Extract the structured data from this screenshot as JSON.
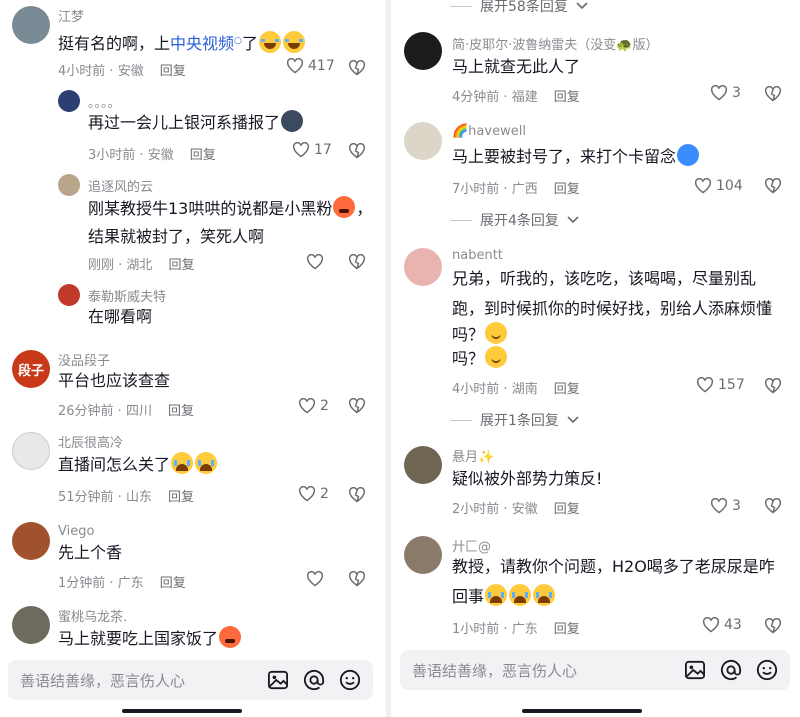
{
  "left": {
    "comments": [
      {
        "user": "江梦",
        "text_a": "挺有名的啊，上",
        "text_link": "中央视频",
        "text_b": "了",
        "time": "4小时前",
        "loc": "安徽",
        "reply": "回复",
        "likes": "417"
      },
      {
        "user": "。。。。",
        "text": "再过一会儿上银河系播报了",
        "time": "3小时前",
        "loc": "安徽",
        "reply": "回复",
        "likes": "17"
      },
      {
        "user": "追逐风的云",
        "text_l1": "刚某教授牛13哄哄的说都是小黑粉",
        "text_l1b": "，",
        "text_l2": "结果就被封了，笑死人啊",
        "time": "刚刚",
        "loc": "湖北",
        "reply": "回复"
      },
      {
        "user": "泰勒斯威夫特",
        "text": "在哪看啊"
      },
      {
        "user": "没品段子",
        "avatar_text": "段子",
        "text": "平台也应该查查",
        "time": "26分钟前",
        "loc": "四川",
        "reply": "回复",
        "likes": "2"
      },
      {
        "user": "北辰很高冷",
        "text": "直播间怎么关了",
        "time": "51分钟前",
        "loc": "山东",
        "reply": "回复",
        "likes": "2"
      },
      {
        "user": "Viego",
        "text": "先上个香",
        "time": "1分钟前",
        "loc": "广东",
        "reply": "回复"
      },
      {
        "user": "蜜桃乌龙茶.",
        "text": "马上就要吃上国家饭了"
      }
    ],
    "input_placeholder": "善语结善缘，恶言伤人心"
  },
  "right": {
    "top_expand": "展开58条回复",
    "comments": [
      {
        "user": "简·皮耶尔·波鲁纳雷夫（没变🐢版）",
        "text": "马上就查无此人了",
        "time": "4分钟前",
        "loc": "福建",
        "reply": "回复",
        "likes": "3"
      },
      {
        "user": "🌈havewell",
        "text": "马上要被封号了，来打个卡留念",
        "time": "7小时前",
        "loc": "广西",
        "reply": "回复",
        "likes": "104",
        "expand": "展开4条回复"
      },
      {
        "user": "nabentt",
        "text_l1": "兄弟，听我的，该吃吃，该喝喝，尽量别乱",
        "text_l2": "跑，到时候抓你的时候好找，别给人添麻烦懂",
        "text_l3": "吗？",
        "text_l4": "吗？",
        "time": "4小时前",
        "loc": "湖南",
        "reply": "回复",
        "likes": "157",
        "expand": "展开1条回复"
      },
      {
        "user": "悬月✨",
        "text": "疑似被外部势力策反!",
        "time": "2小时前",
        "loc": "安徽",
        "reply": "回复",
        "likes": "3"
      },
      {
        "user": "廾匚@",
        "text_l1": "教授，请教你个问题，H2O喝多了老尿尿是咋",
        "text_l2": "回事",
        "time": "1小时前",
        "loc": "广东",
        "reply": "回复",
        "likes": "43"
      }
    ],
    "input_placeholder": "善语结善缘，恶言伤人心"
  },
  "colors": {
    "text": "#161823",
    "meta": "#8a8b91",
    "link": "#2b5fd9",
    "input_bg": "#f2f2f4"
  },
  "icons": [
    "heart-icon",
    "dislike-heart-icon",
    "image-icon",
    "at-icon",
    "emoji-icon",
    "chevron-down-icon",
    "search-small-icon"
  ]
}
